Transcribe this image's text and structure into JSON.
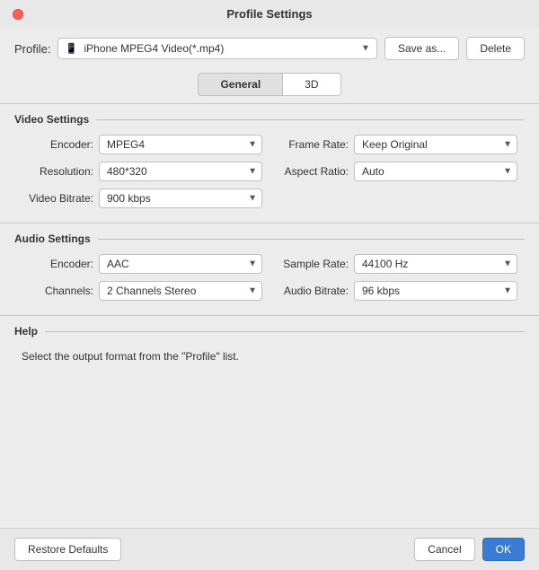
{
  "titleBar": {
    "title": "Profile Settings"
  },
  "profileRow": {
    "label": "Profile:",
    "selectValue": "iPhone MPEG4 Video(*.mp4)",
    "saveAsLabel": "Save as...",
    "deleteLabel": "Delete"
  },
  "tabs": [
    {
      "label": "General",
      "active": true
    },
    {
      "label": "3D",
      "active": false
    }
  ],
  "videoSettings": {
    "sectionTitle": "Video Settings",
    "encoderLabel": "Encoder:",
    "encoderValue": "MPEG4",
    "frameRateLabel": "Frame Rate:",
    "frameRateValue": "Keep Original",
    "resolutionLabel": "Resolution:",
    "resolutionValue": "480*320",
    "aspectRatioLabel": "Aspect Ratio:",
    "aspectRatioValue": "Auto",
    "videoBitrateLabel": "Video Bitrate:",
    "videoBitrateValue": "900 kbps"
  },
  "audioSettings": {
    "sectionTitle": "Audio Settings",
    "encoderLabel": "Encoder:",
    "encoderValue": "AAC",
    "sampleRateLabel": "Sample Rate:",
    "sampleRateValue": "44100 Hz",
    "channelsLabel": "Channels:",
    "channelsValue": "2 Channels Stereo",
    "audioBitrateLabel": "Audio Bitrate:",
    "audioBitrateValue": "96 kbps"
  },
  "help": {
    "sectionTitle": "Help",
    "helpText": "Select the output format from the \"Profile\" list."
  },
  "bottomBar": {
    "restoreDefaultsLabel": "Restore Defaults",
    "cancelLabel": "Cancel",
    "okLabel": "OK"
  }
}
